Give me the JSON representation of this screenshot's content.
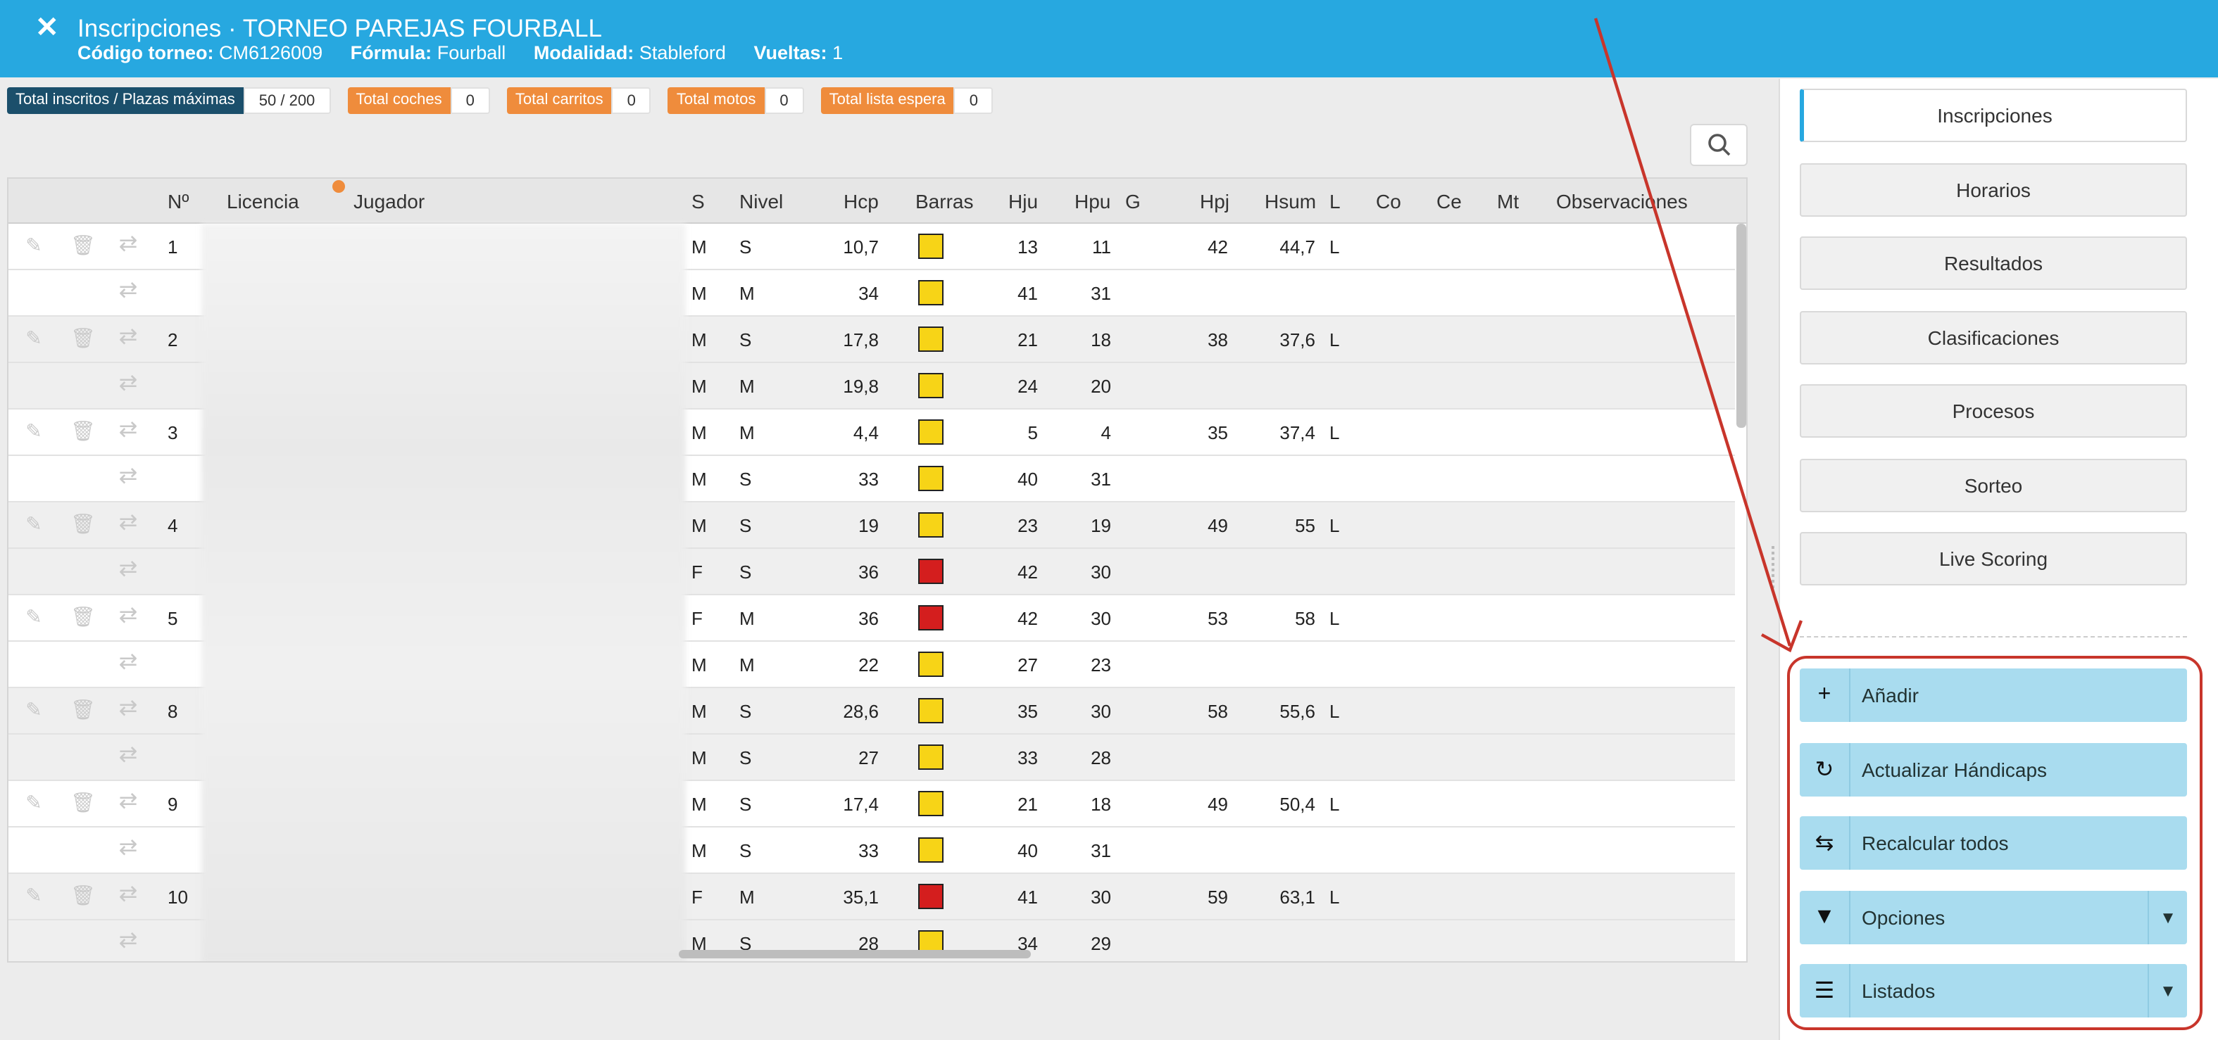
{
  "header": {
    "close_label": "✕",
    "title": "Inscripciones · TORNEO PAREJAS FOURBALL",
    "codigo_label": "Código torneo:",
    "codigo_value": "CM6126009",
    "formula_label": "Fórmula:",
    "formula_value": "Fourball",
    "modalidad_label": "Modalidad:",
    "modalidad_value": "Stableford",
    "vueltas_label": "Vueltas:",
    "vueltas_value": "1"
  },
  "counters": [
    {
      "label": "Total inscritos / Plazas máximas",
      "value": "50 / 200"
    },
    {
      "label": "Total coches",
      "value": "0"
    },
    {
      "label": "Total carritos",
      "value": "0"
    },
    {
      "label": "Total motos",
      "value": "0"
    },
    {
      "label": "Total lista espera",
      "value": "0"
    }
  ],
  "table": {
    "headers": [
      "Nº",
      "Licencia",
      "Jugador",
      "S",
      "Nivel",
      "Hcp",
      "Barras",
      "Hju",
      "Hpu",
      "G",
      "Hpj",
      "Hsum",
      "L",
      "Co",
      "Ce",
      "Mt",
      "Observaciones"
    ],
    "rows": [
      {
        "no": "1",
        "s": "M",
        "nivel": "S",
        "hcp": "10,7",
        "barra": "#f7d417",
        "hju": "13",
        "hpu": "11",
        "hpj": "42",
        "hsum": "44,7",
        "l": "L",
        "first": true
      },
      {
        "no": "",
        "s": "M",
        "nivel": "M",
        "hcp": "34",
        "barra": "#f7d417",
        "hju": "41",
        "hpu": "31",
        "hpj": "",
        "hsum": "",
        "l": "",
        "first": false
      },
      {
        "no": "2",
        "s": "M",
        "nivel": "S",
        "hcp": "17,8",
        "barra": "#f7d417",
        "hju": "21",
        "hpu": "18",
        "hpj": "38",
        "hsum": "37,6",
        "l": "L",
        "first": true
      },
      {
        "no": "",
        "s": "M",
        "nivel": "M",
        "hcp": "19,8",
        "barra": "#f7d417",
        "hju": "24",
        "hpu": "20",
        "hpj": "",
        "hsum": "",
        "l": "",
        "first": false
      },
      {
        "no": "3",
        "s": "M",
        "nivel": "M",
        "hcp": "4,4",
        "barra": "#f7d417",
        "hju": "5",
        "hpu": "4",
        "hpj": "35",
        "hsum": "37,4",
        "l": "L",
        "first": true
      },
      {
        "no": "",
        "s": "M",
        "nivel": "S",
        "hcp": "33",
        "barra": "#f7d417",
        "hju": "40",
        "hpu": "31",
        "hpj": "",
        "hsum": "",
        "l": "",
        "first": false
      },
      {
        "no": "4",
        "s": "M",
        "nivel": "S",
        "hcp": "19",
        "barra": "#f7d417",
        "hju": "23",
        "hpu": "19",
        "hpj": "49",
        "hsum": "55",
        "l": "L",
        "first": true
      },
      {
        "no": "",
        "s": "F",
        "nivel": "S",
        "hcp": "36",
        "barra": "#d41e1e",
        "hju": "42",
        "hpu": "30",
        "hpj": "",
        "hsum": "",
        "l": "",
        "first": false
      },
      {
        "no": "5",
        "s": "F",
        "nivel": "M",
        "hcp": "36",
        "barra": "#d41e1e",
        "hju": "42",
        "hpu": "30",
        "hpj": "53",
        "hsum": "58",
        "l": "L",
        "first": true
      },
      {
        "no": "",
        "s": "M",
        "nivel": "M",
        "hcp": "22",
        "barra": "#f7d417",
        "hju": "27",
        "hpu": "23",
        "hpj": "",
        "hsum": "",
        "l": "",
        "first": false
      },
      {
        "no": "8",
        "s": "M",
        "nivel": "S",
        "hcp": "28,6",
        "barra": "#f7d417",
        "hju": "35",
        "hpu": "30",
        "hpj": "58",
        "hsum": "55,6",
        "l": "L",
        "first": true
      },
      {
        "no": "",
        "s": "M",
        "nivel": "S",
        "hcp": "27",
        "barra": "#f7d417",
        "hju": "33",
        "hpu": "28",
        "hpj": "",
        "hsum": "",
        "l": "",
        "first": false
      },
      {
        "no": "9",
        "s": "M",
        "nivel": "S",
        "hcp": "17,4",
        "barra": "#f7d417",
        "hju": "21",
        "hpu": "18",
        "hpj": "49",
        "hsum": "50,4",
        "l": "L",
        "first": true
      },
      {
        "no": "",
        "s": "M",
        "nivel": "S",
        "hcp": "33",
        "barra": "#f7d417",
        "hju": "40",
        "hpu": "31",
        "hpj": "",
        "hsum": "",
        "l": "",
        "first": false
      },
      {
        "no": "10",
        "s": "F",
        "nivel": "M",
        "hcp": "35,1",
        "barra": "#d41e1e",
        "hju": "41",
        "hpu": "30",
        "hpj": "59",
        "hsum": "63,1",
        "l": "L",
        "first": true
      },
      {
        "no": "",
        "s": "M",
        "nivel": "S",
        "hcp": "28",
        "barra": "#f7d417",
        "hju": "34",
        "hpu": "29",
        "hpj": "",
        "hsum": "",
        "l": "",
        "first": false
      }
    ]
  },
  "nav": [
    "Inscripciones",
    "Horarios",
    "Resultados",
    "Clasificaciones",
    "Procesos",
    "Sorteo",
    "Live Scoring"
  ],
  "actions": [
    {
      "label": "Añadir",
      "icon": "plus-icon",
      "glyph": "+",
      "dropdown": false
    },
    {
      "label": "Actualizar Hándicaps",
      "icon": "refresh-icon",
      "glyph": "↻",
      "dropdown": false
    },
    {
      "label": "Recalcular todos",
      "icon": "recycle-icon",
      "glyph": "⇆",
      "dropdown": false
    },
    {
      "label": "Opciones",
      "icon": "filter-icon",
      "glyph": "▼",
      "dropdown": true
    },
    {
      "label": "Listados",
      "icon": "list-icon",
      "glyph": "☰",
      "dropdown": true
    }
  ],
  "colors": {
    "header": "#27a8e0",
    "annotation": "#c8352b",
    "action_bg": "#a9dcef"
  }
}
